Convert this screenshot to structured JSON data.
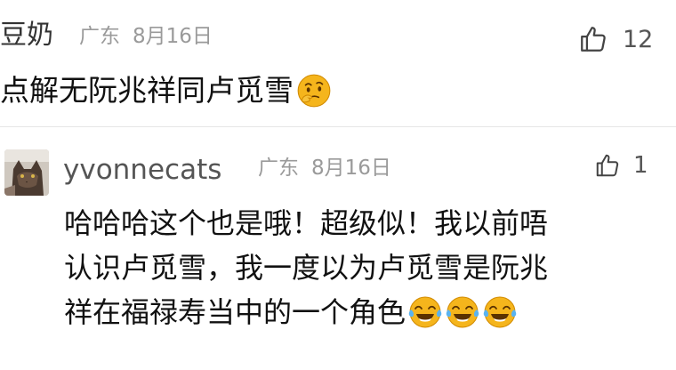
{
  "comment": {
    "username": "豆奶",
    "location": "广东",
    "date": "8月16日",
    "likes": "12",
    "text": "点解无阮兆祥同卢觅雪",
    "emoji": "thinking-face-icon"
  },
  "reply": {
    "username": "yvonnecats",
    "location": "广东",
    "date": "8月16日",
    "likes": "1",
    "lines": [
      "哈哈哈这个也是哦！超级似！我以前唔",
      "认识卢觅雪，我一度以为卢觅雪是阮兆",
      "祥在福禄寿当中的一个角色"
    ],
    "emoji": "tears-of-joy-icon",
    "emoji_count": 3
  },
  "colors": {
    "meta_gray": "#9a9a9a",
    "text": "#111111",
    "emoji_yellow": "#f5b51c"
  }
}
